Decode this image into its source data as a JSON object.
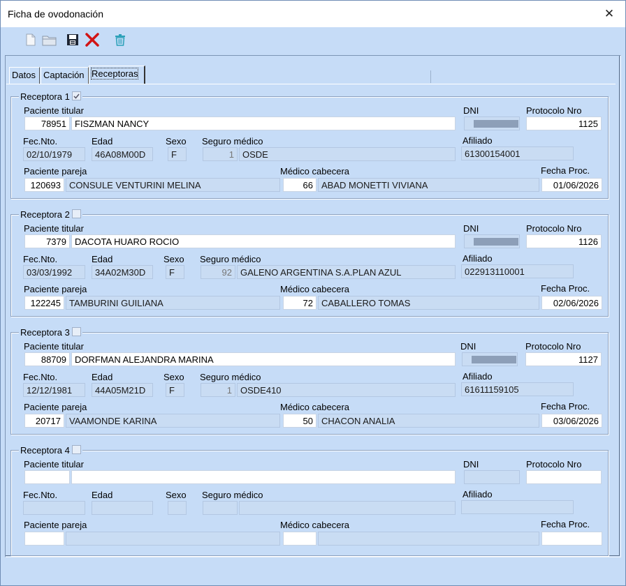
{
  "window": {
    "title": "Ficha de ovodonación"
  },
  "toolbar": {
    "new_icon": "new-document-icon",
    "open_icon": "open-folder-icon",
    "save_icon": "save-disk-icon",
    "delete_icon": "delete-x-icon",
    "trash_icon": "trash-can-icon"
  },
  "tabs": [
    {
      "label": "Datos"
    },
    {
      "label": "Captación"
    },
    {
      "label": "Receptoras"
    }
  ],
  "labels": {
    "paciente_titular": "Paciente titular",
    "dni": "DNI",
    "protocolo": "Protocolo Nro",
    "fec_nto": "Fec.Nto.",
    "edad": "Edad",
    "sexo": "Sexo",
    "seguro": "Seguro médico",
    "afiliado": "Afiliado",
    "paciente_pareja": "Paciente pareja",
    "medico": "Médico cabecera",
    "fecha_proc": "Fecha Proc."
  },
  "receptoras": [
    {
      "title": "Receptora 1",
      "checked": true,
      "titular_id": "78951",
      "titular_nombre": "FISZMAN NANCY",
      "dni": "",
      "protocolo": "1125",
      "fec_nto": "02/10/1979",
      "edad": "46A08M00D",
      "sexo": "F",
      "seguro_id": "1",
      "seguro_nombre": "OSDE",
      "afiliado": "61300154001",
      "pareja_id": "120693",
      "pareja_nombre": "CONSULE VENTURINI MELINA",
      "medico_id": "66",
      "medico_nombre": "ABAD MONETTI VIVIANA",
      "fecha_proc": "01/06/2026"
    },
    {
      "title": "Receptora 2",
      "checked": false,
      "titular_id": "7379",
      "titular_nombre": "DACOTA HUARO ROCIO",
      "dni": "",
      "protocolo": "1126",
      "fec_nto": "03/03/1992",
      "edad": "34A02M30D",
      "sexo": "F",
      "seguro_id": "92",
      "seguro_nombre": "GALENO ARGENTINA S.A.PLAN AZUL",
      "afiliado": "022913110001",
      "pareja_id": "122245",
      "pareja_nombre": "TAMBURINI GUILIANA",
      "medico_id": "72",
      "medico_nombre": "CABALLERO TOMAS",
      "fecha_proc": "02/06/2026"
    },
    {
      "title": "Receptora 3",
      "checked": false,
      "titular_id": "88709",
      "titular_nombre": "DORFMAN ALEJANDRA MARINA",
      "dni": "",
      "protocolo": "1127",
      "fec_nto": "12/12/1981",
      "edad": "44A05M21D",
      "sexo": "F",
      "seguro_id": "1",
      "seguro_nombre": "OSDE410",
      "afiliado": "61611159105",
      "pareja_id": "20717",
      "pareja_nombre": "VAAMONDE KARINA",
      "medico_id": "50",
      "medico_nombre": "CHACON ANALIA",
      "fecha_proc": "03/06/2026"
    },
    {
      "title": "Receptora 4",
      "checked": false,
      "titular_id": "",
      "titular_nombre": "",
      "dni": "",
      "protocolo": "",
      "fec_nto": "",
      "edad": "",
      "sexo": "",
      "seguro_id": "",
      "seguro_nombre": "",
      "afiliado": "",
      "pareja_id": "",
      "pareja_nombre": "",
      "medico_id": "",
      "medico_nombre": "",
      "fecha_proc": ""
    }
  ]
}
